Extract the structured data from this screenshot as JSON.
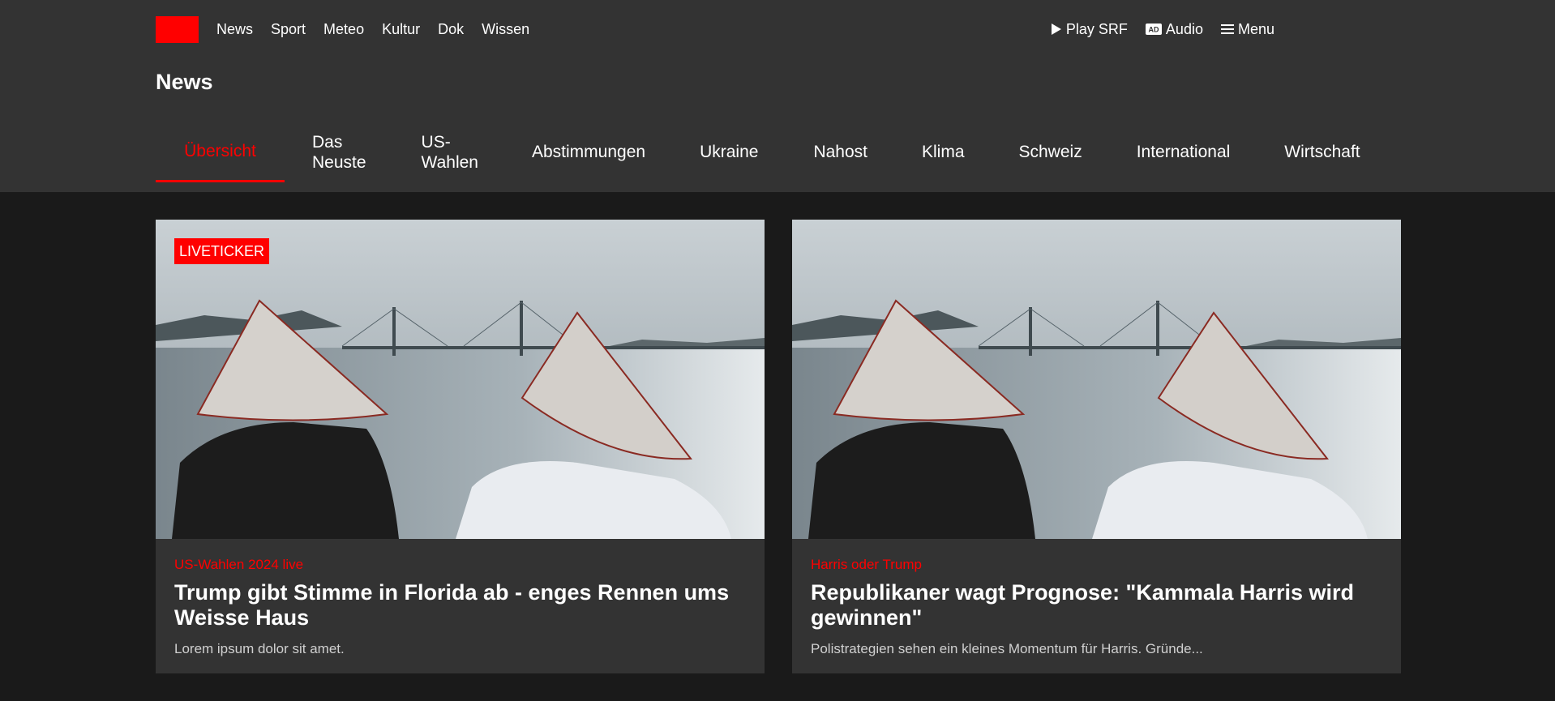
{
  "nav": {
    "main": [
      "News",
      "Sport",
      "Meteo",
      "Kultur",
      "Dok",
      "Wissen"
    ],
    "play": "Play SRF",
    "audio_badge": "AD",
    "audio": "Audio",
    "menu": "Menu"
  },
  "page": {
    "title": "News"
  },
  "subnav": [
    {
      "line1": "Übersicht",
      "line2": ""
    },
    {
      "line1": "Das",
      "line2": "Neuste"
    },
    {
      "line1": "US-",
      "line2": "Wahlen"
    },
    {
      "line1": "Abstimmungen",
      "line2": ""
    },
    {
      "line1": "Ukraine",
      "line2": ""
    },
    {
      "line1": "Nahost",
      "line2": ""
    },
    {
      "line1": "Klima",
      "line2": ""
    },
    {
      "line1": "Schweiz",
      "line2": ""
    },
    {
      "line1": "International",
      "line2": ""
    },
    {
      "line1": "Wirtschaft",
      "line2": ""
    }
  ],
  "cards": [
    {
      "badge": "LIVETICKER",
      "kicker": "US-Wahlen 2024 live",
      "headline": "Trump gibt Stimme in Florida ab - enges Rennen ums Weisse Haus",
      "teaser": "Lorem ipsum dolor sit amet."
    },
    {
      "badge": "",
      "kicker": "Harris oder Trump",
      "headline": "Republikaner wagt Prognose: \"Kammala Harris wird gewinnen\"",
      "teaser": "Polistrategien sehen ein kleines Momentum für Harris. Gründe..."
    }
  ],
  "colors": {
    "accent": "#ff0000",
    "header_bg": "#333333",
    "page_bg": "#1a1a1a"
  },
  "icons": {
    "play": "play-icon",
    "audio": "audio-description-icon",
    "menu": "hamburger-menu-icon"
  }
}
